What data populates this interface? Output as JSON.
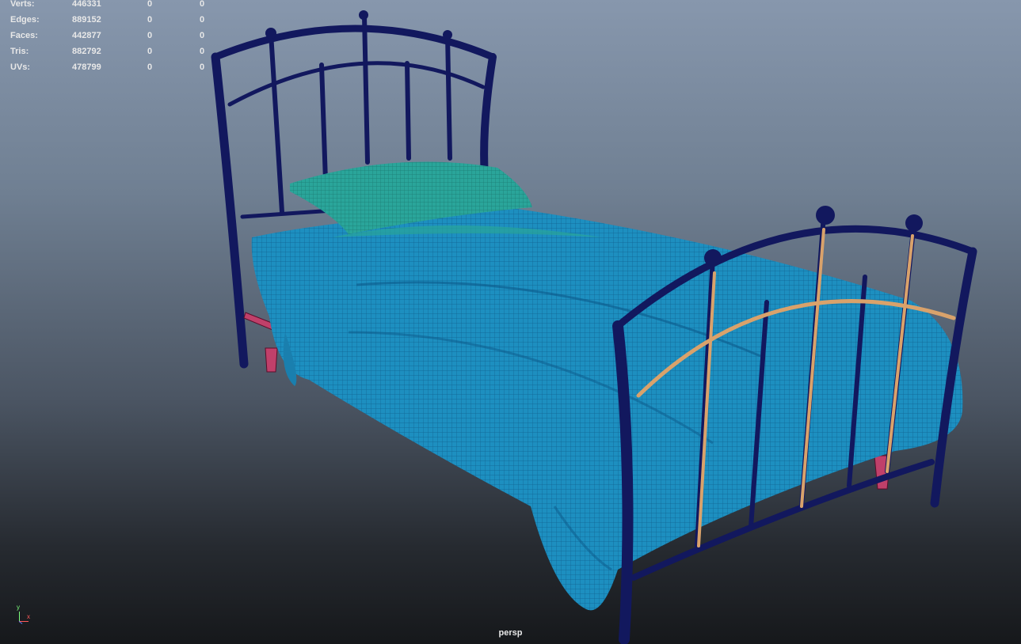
{
  "hud": {
    "rows": [
      {
        "label": "Verts:",
        "total": "446331",
        "selected": "0",
        "component": "0"
      },
      {
        "label": "Edges:",
        "total": "889152",
        "selected": "0",
        "component": "0"
      },
      {
        "label": "Faces:",
        "total": "442877",
        "selected": "0",
        "component": "0"
      },
      {
        "label": "Tris:",
        "total": "882792",
        "selected": "0",
        "component": "0"
      },
      {
        "label": "UVs:",
        "total": "478799",
        "selected": "0",
        "component": "0"
      }
    ]
  },
  "viewport": {
    "camera": "persp",
    "background_top": "#8797ad",
    "background_bottom": "#16181b"
  },
  "axis": {
    "y": "y",
    "x": "x"
  },
  "colors": {
    "frame": "#12185e",
    "comforter": "#1d8fc0",
    "pillow": "#2aa59a",
    "highlight": "#d9a26b",
    "feet": "#c0406a"
  },
  "icons": [
    "axis-gizmo-icon"
  ]
}
